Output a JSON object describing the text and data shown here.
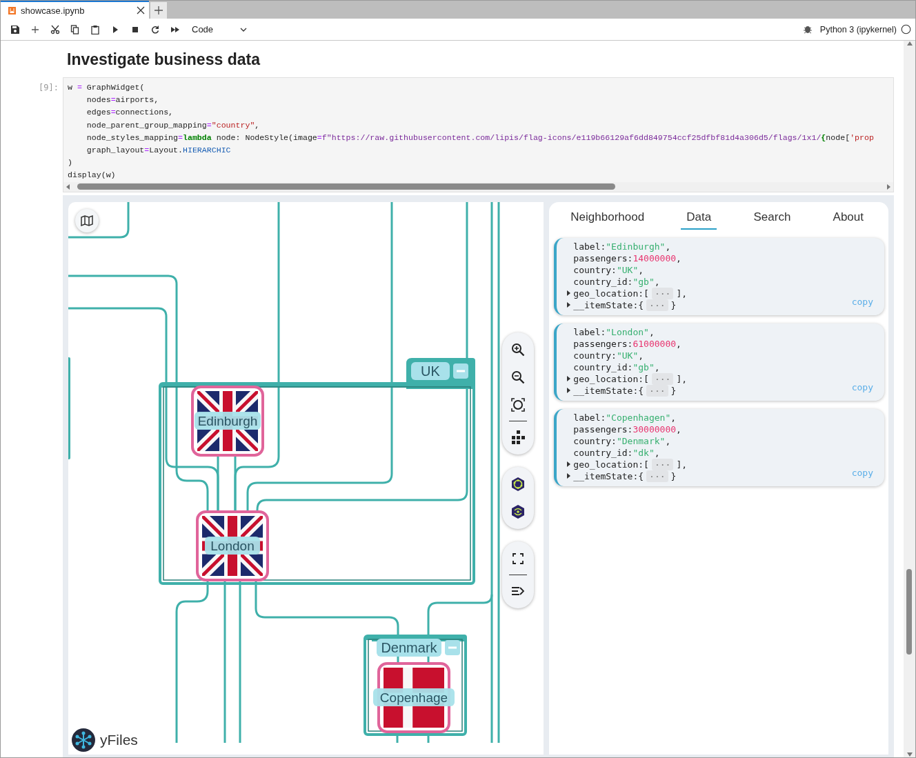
{
  "tabs": [
    {
      "label": "showcase.ipynb",
      "selected": true
    }
  ],
  "toolbar": {
    "cell_type": "Code",
    "kernel": "Python 3 (ipykernel)"
  },
  "heading": "Investigate business data",
  "cell": {
    "prompt": "[9]:",
    "lines": [
      [
        {
          "text": "w ",
          "kind": "plain"
        },
        {
          "text": "=",
          "kind": "op"
        },
        {
          "text": " GraphWidget(",
          "kind": "plain"
        }
      ],
      [
        {
          "text": "    nodes",
          "kind": "plain"
        },
        {
          "text": "=",
          "kind": "op"
        },
        {
          "text": "airports,",
          "kind": "plain"
        }
      ],
      [
        {
          "text": "    edges",
          "kind": "plain"
        },
        {
          "text": "=",
          "kind": "op"
        },
        {
          "text": "connections,",
          "kind": "plain"
        }
      ],
      [
        {
          "text": "    node_parent_group_mapping",
          "kind": "plain"
        },
        {
          "text": "=",
          "kind": "op"
        },
        {
          "text": "\"country\"",
          "kind": "str"
        },
        {
          "text": ",",
          "kind": "plain"
        }
      ],
      [
        {
          "text": "    node_styles_mapping",
          "kind": "plain"
        },
        {
          "text": "=",
          "kind": "op"
        },
        {
          "text": "lambda",
          "kind": "kw"
        },
        {
          "text": " node: NodeStyle(image",
          "kind": "plain"
        },
        {
          "text": "=",
          "kind": "op"
        },
        {
          "text": "f\"https://raw.githubusercontent.com/lipis/flag-icons/e119b66129af6dd849754ccf25dfbf81d4a306d5/flags/1x1/",
          "kind": "fstr"
        },
        {
          "text": "{",
          "kind": "kw"
        },
        {
          "text": "node[",
          "kind": "plain"
        },
        {
          "text": "'prop",
          "kind": "str"
        }
      ],
      [
        {
          "text": "    graph_layout",
          "kind": "plain"
        },
        {
          "text": "=",
          "kind": "op"
        },
        {
          "text": "Layout.",
          "kind": "plain"
        },
        {
          "text": "HIERARCHIC",
          "kind": "attr"
        }
      ],
      [
        {
          "text": ")",
          "kind": "plain"
        }
      ],
      [
        {
          "text": "display(w)",
          "kind": "plain"
        }
      ]
    ]
  },
  "graph": {
    "groups": [
      {
        "label": "UK",
        "expanded": true
      },
      {
        "label": "Denmark",
        "expanded": true
      }
    ],
    "nodes": [
      {
        "label": "Edinburgh",
        "kind": "uk"
      },
      {
        "label": "London",
        "kind": "uk"
      },
      {
        "label": "Copenhage",
        "kind": "dk"
      }
    ],
    "brand": "yFiles"
  },
  "panel": {
    "tabs": [
      {
        "label": "Neighborhood",
        "selected": false
      },
      {
        "label": "Data",
        "selected": true
      },
      {
        "label": "Search",
        "selected": false
      },
      {
        "label": "About",
        "selected": false
      }
    ],
    "records": [
      {
        "copy": "copy",
        "fields": [
          {
            "kind": "string",
            "key": "label:",
            "value": "\"Edinburgh\"",
            "tail": ","
          },
          {
            "kind": "number",
            "key": "passengers:",
            "value": "14000000",
            "tail": ","
          },
          {
            "kind": "string",
            "key": "country:",
            "value": "\"UK\"",
            "tail": ","
          },
          {
            "kind": "string",
            "key": "country_id:",
            "value": "\"gb\"",
            "tail": ","
          },
          {
            "kind": "collapsed",
            "expanded": false,
            "key": "geo_location:",
            "open": "[",
            "value": "···",
            "tail": "],"
          },
          {
            "kind": "collapsed",
            "expanded": false,
            "key": "__itemState:",
            "open": "{",
            "value": "···",
            "tail": "}"
          }
        ]
      },
      {
        "copy": "copy",
        "fields": [
          {
            "kind": "string",
            "key": "label:",
            "value": "\"London\"",
            "tail": ","
          },
          {
            "kind": "number",
            "key": "passengers:",
            "value": "61000000",
            "tail": ","
          },
          {
            "kind": "string",
            "key": "country:",
            "value": "\"UK\"",
            "tail": ","
          },
          {
            "kind": "string",
            "key": "country_id:",
            "value": "\"gb\"",
            "tail": ","
          },
          {
            "kind": "collapsed",
            "expanded": false,
            "key": "geo_location:",
            "open": "[",
            "value": "···",
            "tail": "],"
          },
          {
            "kind": "collapsed",
            "expanded": false,
            "key": "__itemState:",
            "open": "{",
            "value": "···",
            "tail": "}"
          }
        ]
      },
      {
        "copy": "copy",
        "fields": [
          {
            "kind": "string",
            "key": "label:",
            "value": "\"Copenhagen\"",
            "tail": ","
          },
          {
            "kind": "number",
            "key": "passengers:",
            "value": "30000000",
            "tail": ","
          },
          {
            "kind": "string",
            "key": "country:",
            "value": "\"Denmark\"",
            "tail": ","
          },
          {
            "kind": "string",
            "key": "country_id:",
            "value": "\"dk\"",
            "tail": ","
          },
          {
            "kind": "collapsed",
            "expanded": false,
            "key": "geo_location:",
            "open": "[",
            "value": "···",
            "tail": "],"
          },
          {
            "kind": "collapsed",
            "expanded": false,
            "key": "__itemState:",
            "open": "{",
            "value": "···",
            "tail": "}"
          }
        ]
      }
    ]
  }
}
